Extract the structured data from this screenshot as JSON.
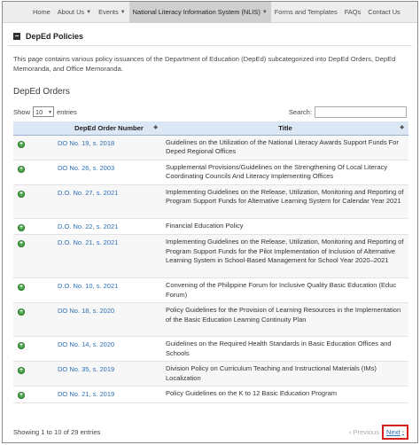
{
  "nav": {
    "items": [
      {
        "label": "Home",
        "caret": false,
        "active": false
      },
      {
        "label": "About Us",
        "caret": true,
        "active": false
      },
      {
        "label": "Events",
        "caret": true,
        "active": false
      },
      {
        "label": "National Literacy Information System (NLIS)",
        "caret": true,
        "active": true
      },
      {
        "label": "Forms and Templates",
        "caret": false,
        "active": false
      },
      {
        "label": "FAQs",
        "caret": false,
        "active": false
      },
      {
        "label": "Contact Us",
        "caret": false,
        "active": false
      }
    ]
  },
  "panel": {
    "title": "DepEd Policies",
    "toggle_symbol": "−",
    "description": "This page contains various policy issuances of the Department of Education (DepEd) subcategorized into DepEd Orders, DepEd Memoranda, and Office Memoranda."
  },
  "section": {
    "title": "DepEd Orders"
  },
  "controls": {
    "show_label": "Show",
    "entries_value": "10",
    "entries_label": "entries",
    "search_label": "Search:",
    "search_value": ""
  },
  "table": {
    "headers": {
      "number": "DepEd Order Number",
      "title": "Title"
    },
    "rows": [
      {
        "number": "DO No. 19, s. 2018",
        "title": "Guidelines on the Utilization of the National Literacy Awards Support Funds For Deped Regional Offices"
      },
      {
        "number": "DO No. 26, s. 2003",
        "title": "Supplemental Provisions/Guidelines on the Strengthening Of Local Literacy Coordinating Councils And Literacy Implementing Offices"
      },
      {
        "number": "D.O. No. 27, s. 2021",
        "title": "Implementing Guidelines on the Release, Utilization, Monitoring and Reporting of Program Support Funds for Alternative Learning System for Calendar Year 2021"
      },
      {
        "number": "D.O. No. 22, s. 2021",
        "title": "Financial Education Policy"
      },
      {
        "number": "D.O. No. 21, s. 2021",
        "title": "Implementing Guidelines on the Release, Utilization, Monitoring and Reporting of Program Support Funds for the Pilot Implementation of Inclusion of Alternative Learning System in School-Based Management for School Year 2020–2021"
      },
      {
        "number": "D.O. No. 10, s. 2021",
        "title": "Convening of the Philippine Forum for Inclusive Quality Basic Education (Educ Forum)"
      },
      {
        "number": "DO No. 18, s. 2020",
        "title": "Policy Guidelines for the Provision of Learning Resources in the Implementation of the Basic Education Learning Continuity Plan"
      },
      {
        "number": "DO No. 14, s. 2020",
        "title": "Guidelines on the Required Health Standards in Basic Education Offices and Schools"
      },
      {
        "number": "DO No. 35, s. 2019",
        "title": "Division Policy on Curriculum Teaching and Instructional Materials (IMs) Localization"
      },
      {
        "number": "DO No. 21, s. 2019",
        "title": "Policy Guidelines on the K to 12 Basic Education Program"
      }
    ]
  },
  "footer": {
    "info": "Showing 1 to 10 of 29 entries",
    "previous": "Previous",
    "next": "Next"
  },
  "colors": {
    "link": "#2b6fb6",
    "header_bg": "#dbe7f5",
    "expand_icon": "#4aa84a",
    "highlight": "#d62020"
  }
}
